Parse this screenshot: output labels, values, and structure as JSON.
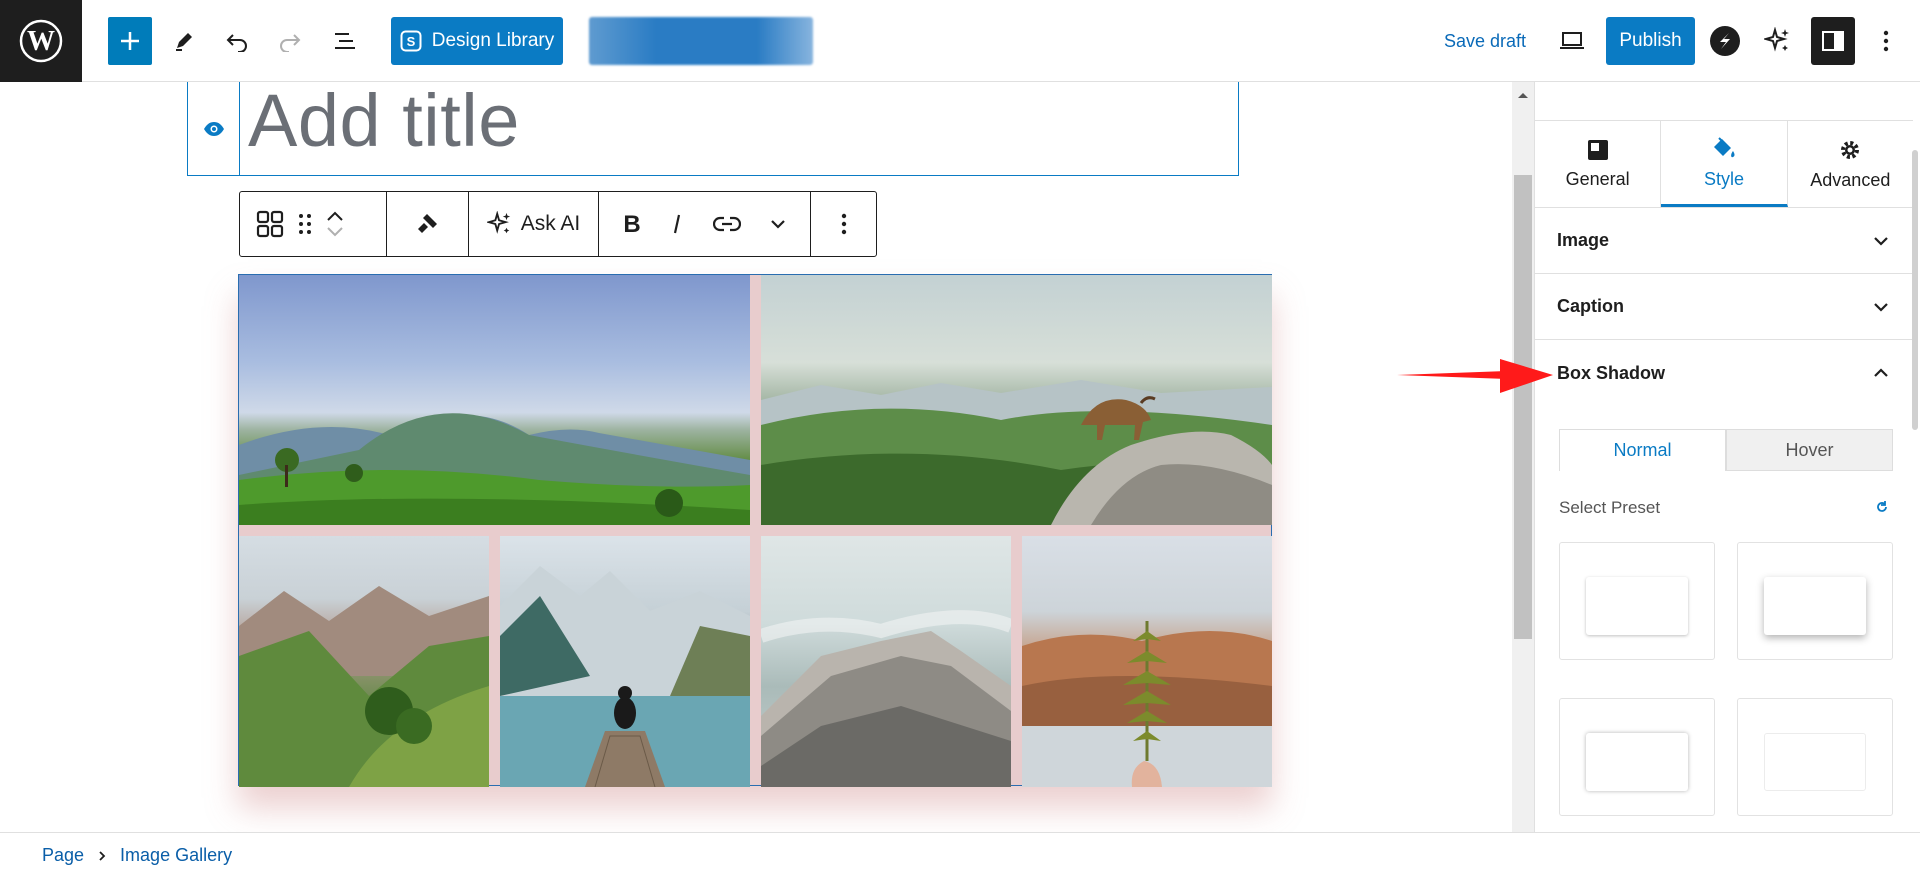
{
  "toolbar": {
    "design_library_label": "Design Library",
    "save_draft_label": "Save draft",
    "publish_label": "Publish"
  },
  "editor": {
    "title_placeholder": "Add title",
    "block_toolbar": {
      "ask_ai_label": "Ask AI"
    }
  },
  "panel": {
    "tabs": [
      {
        "label": "General"
      },
      {
        "label": "Style"
      },
      {
        "label": "Advanced"
      }
    ],
    "sections": {
      "image": "Image",
      "caption": "Caption",
      "box_shadow": "Box Shadow"
    },
    "state_tabs": {
      "normal": "Normal",
      "hover": "Hover"
    },
    "select_preset_label": "Select Preset"
  },
  "breadcrumb": {
    "items": [
      "Page",
      "Image Gallery"
    ]
  },
  "colors": {
    "accent": "#0a7bc4",
    "dark": "#1e1e1e",
    "annotation_arrow": "#ff1a1a"
  }
}
